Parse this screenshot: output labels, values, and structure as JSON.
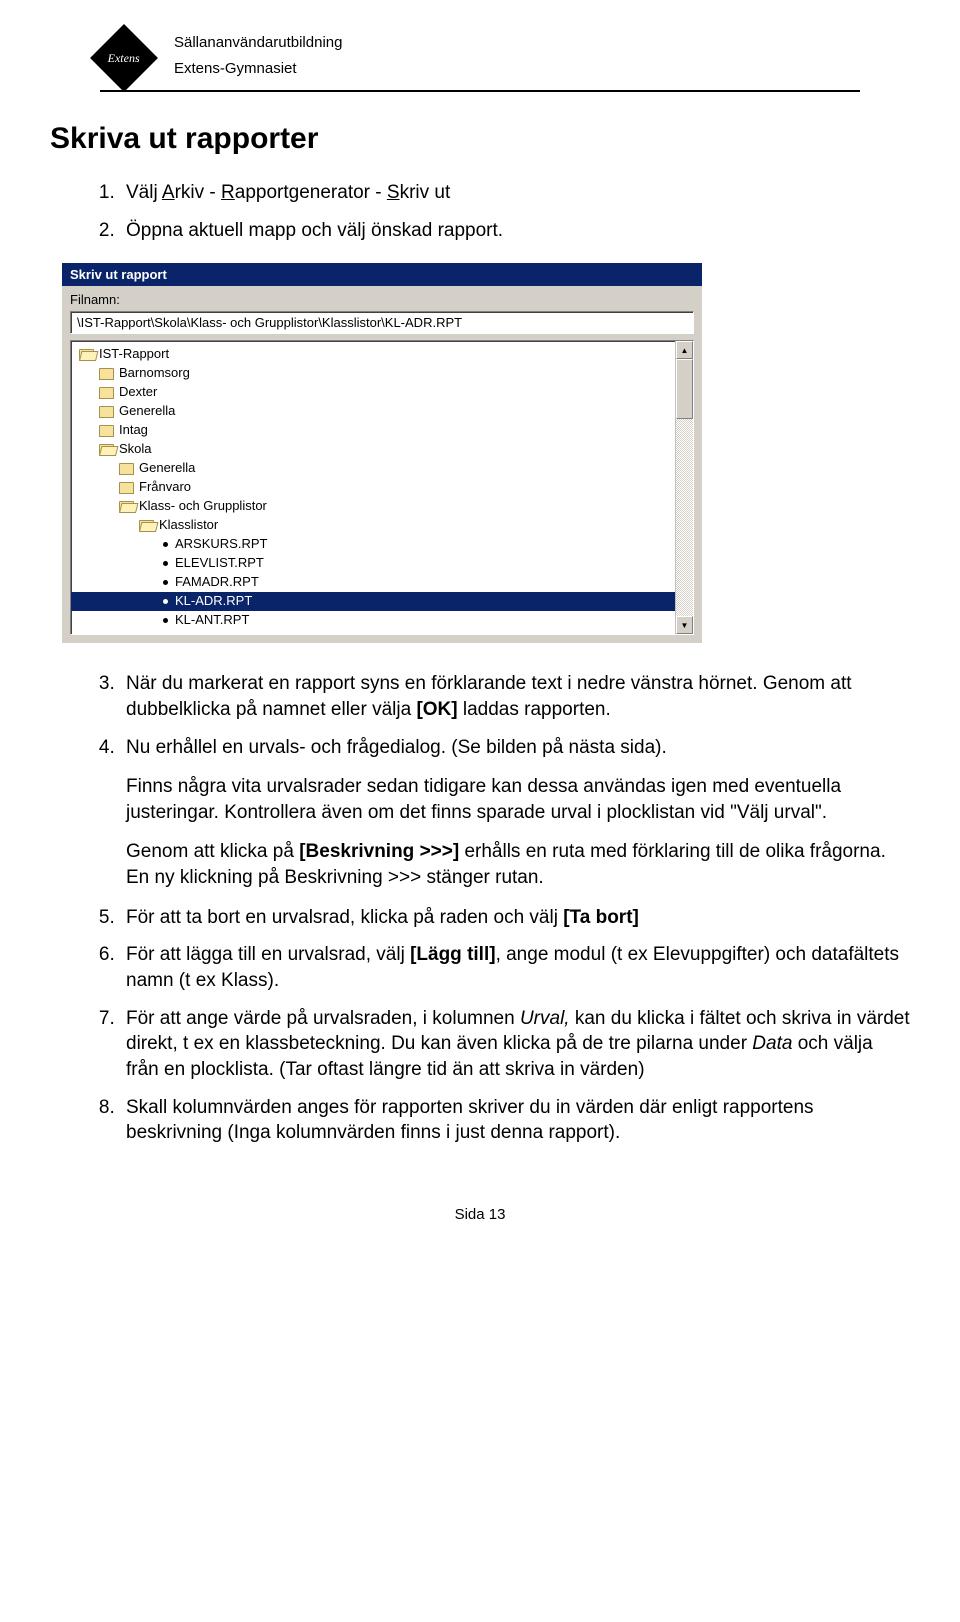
{
  "header": {
    "logo_text": "Extens",
    "line1": "Sällananvändarutbildning",
    "line2": "Extens-Gymnasiet"
  },
  "title": "Skriva ut rapporter",
  "list": {
    "item1_prefix": "Välj ",
    "item1_a": "A",
    "item1_arkiv_rest": "rkiv - ",
    "item1_r": "R",
    "item1_rapport_rest": "apportgenerator - ",
    "item1_s": "S",
    "item1_skriv_rest": "kriv ut",
    "item2": "Öppna aktuell mapp och välj önskad rapport.",
    "item3": "När du markerat en rapport syns en förklarande text i nedre vänstra hörnet. Genom att dubbelklicka på namnet eller välja ",
    "item3_ok": "[OK]",
    "item3_rest": " laddas rapporten.",
    "item4": "Nu erhållel en urvals- och frågedialog. (Se bilden på nästa sida).",
    "item4_p1": "Finns några vita urvalsrader sedan tidigare kan dessa användas igen med eventuella justeringar. Kontrollera även om det finns sparade urval i plocklistan vid \"Välj urval\".",
    "item4_p2a": "Genom att klicka på ",
    "item4_p2b": "[Beskrivning >>>]",
    "item4_p2c": " erhålls en ruta med förklaring till de olika frågorna. En ny klickning på  Beskrivning >>> stänger rutan.",
    "item5a": "För att ta bort en urvalsrad, klicka på raden och välj ",
    "item5b": "[Ta bort]",
    "item6a": "För att lägga till en urvalsrad, välj ",
    "item6b": "[Lägg till]",
    "item6c": ", ange modul (t ex Elevuppgifter) och datafältets namn (t ex Klass).",
    "item7a": "För att ange värde på urvalsraden, i kolumnen ",
    "item7b": "Urval,",
    "item7c": " kan du klicka i fältet och skriva in värdet direkt, t ex en klassbeteckning. Du kan även klicka på de tre pilarna under ",
    "item7d": "Data",
    "item7e": " och välja från en plocklista. (Tar oftast längre tid än att skriva in värden)",
    "item8": "Skall kolumnvärden anges för rapporten skriver du in värden där enligt rapportens beskrivning (Inga kolumnvärden finns i just denna rapport)."
  },
  "dialog": {
    "title": "Skriv ut rapport",
    "filnamn_label": "Filnamn:",
    "path": "\\IST-Rapport\\Skola\\Klass- och Grupplistor\\Klasslistor\\KL-ADR.RPT",
    "tree": [
      {
        "indent": 8,
        "icon": "folder-open",
        "label": "IST-Rapport"
      },
      {
        "indent": 28,
        "icon": "folder",
        "label": "Barnomsorg"
      },
      {
        "indent": 28,
        "icon": "folder",
        "label": "Dexter"
      },
      {
        "indent": 28,
        "icon": "folder",
        "label": "Generella"
      },
      {
        "indent": 28,
        "icon": "folder",
        "label": "Intag"
      },
      {
        "indent": 28,
        "icon": "folder-open",
        "label": "Skola"
      },
      {
        "indent": 48,
        "icon": "folder",
        "label": "Generella"
      },
      {
        "indent": 48,
        "icon": "folder",
        "label": "Frånvaro"
      },
      {
        "indent": 48,
        "icon": "folder-open",
        "label": "Klass- och Grupplistor"
      },
      {
        "indent": 68,
        "icon": "folder-open",
        "label": "Klasslistor"
      },
      {
        "indent": 90,
        "icon": "dot",
        "label": "ARSKURS.RPT"
      },
      {
        "indent": 90,
        "icon": "dot",
        "label": "ELEVLIST.RPT"
      },
      {
        "indent": 90,
        "icon": "dot",
        "label": "FAMADR.RPT"
      },
      {
        "indent": 90,
        "icon": "dot",
        "label": "KL-ADR.RPT",
        "selected": true
      },
      {
        "indent": 90,
        "icon": "dot",
        "label": "KL-ANT.RPT"
      }
    ]
  },
  "footer": "Sida 13"
}
